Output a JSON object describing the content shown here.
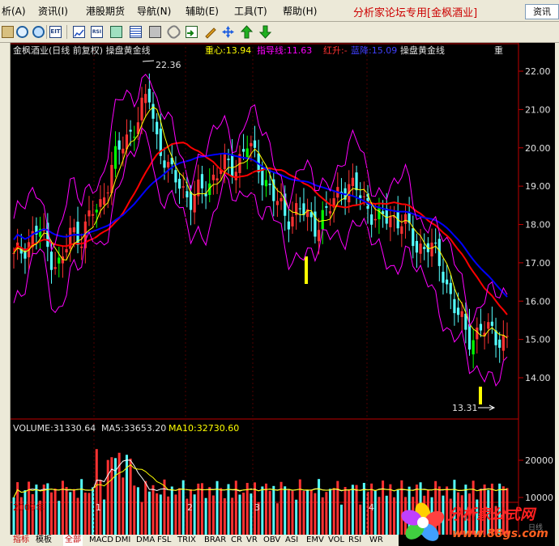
{
  "menu": {
    "items": [
      "析(A)",
      "资讯(I)",
      "港股期货",
      "导航(N)",
      "辅助(E)",
      "工具(T)",
      "帮助(H)"
    ],
    "promo": "分析家论坛专用[金枫酒业]",
    "search_label": "资讯"
  },
  "toolbar": {
    "icons": [
      "paste-icon",
      "zoom-in-icon",
      "zoom-out-icon",
      "find-icon",
      "eit-icon",
      "line-chart-icon",
      "rsi-icon",
      "image-icon",
      "list-icon",
      "calculator-icon",
      "link-icon",
      "import-icon",
      "pencil-icon",
      "cross-arrows-icon",
      "up-arrow-icon",
      "down-arrow-icon"
    ],
    "eit_label": "EIT",
    "rsi_label": "RSI"
  },
  "legend": {
    "title": "金枫酒业(日线 前复权) 操盘黄金线",
    "zhongxin": "重心:13.94",
    "zhidao": "指导线:11.63",
    "hongsheng": "红升:-",
    "lanjiang": "蓝降:15.09",
    "caopan": "操盘黄金线",
    "right_mark": "重"
  },
  "price_axis": {
    "ticks": [
      "22.00",
      "21.00",
      "20.00",
      "19.00",
      "18.00",
      "17.00",
      "16.00",
      "15.00",
      "14.00"
    ]
  },
  "annotations": {
    "high_label": "22.36",
    "low_label": "13.31"
  },
  "volume_legend": {
    "volume": "VOLUME:31330.64",
    "ma5": "MA5:33653.20",
    "ma10": "MA10:32730.60"
  },
  "volume_axis": {
    "ticks": [
      "20000",
      "10000"
    ]
  },
  "time_axis": {
    "year": "2009年",
    "months": [
      "1",
      "2",
      "3",
      "4"
    ]
  },
  "bottom_tabs": [
    "指标",
    "模板",
    "全部",
    "MACD",
    "DMI",
    "DMA",
    "FSL",
    "TRIX",
    "BRAR",
    "CR",
    "VR",
    "OBV",
    "ASI",
    "EMV",
    "VOL",
    "RSI",
    "WR"
  ],
  "logo": {
    "brand": "分析家公式网",
    "url": "www.88gs.com",
    "watermark": "日线"
  },
  "colors": {
    "up": "#ff3232",
    "down": "#54ffff",
    "up_green": "#00ff00",
    "blue_line": "#0000ff",
    "red_line": "#ff0000",
    "magenta": "#ff00ff",
    "yellow_line": "#ffff00",
    "axis": "#c00000"
  }
}
